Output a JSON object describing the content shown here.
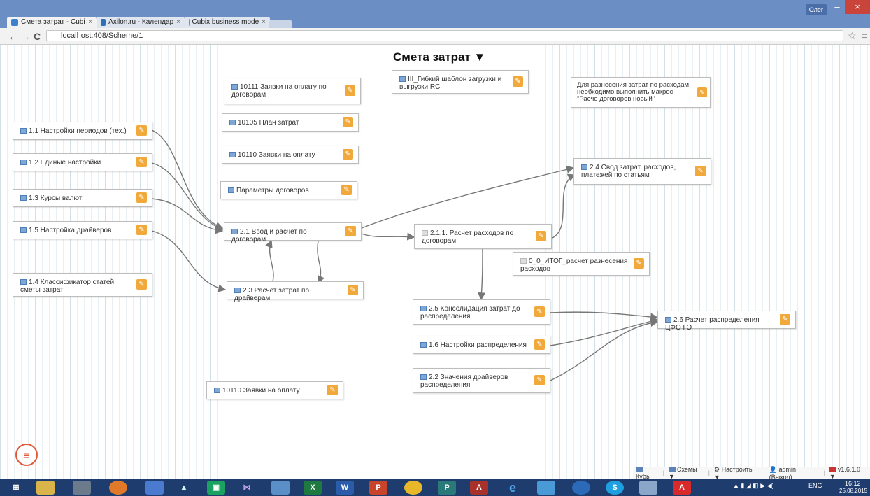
{
  "browser": {
    "tabs": [
      {
        "label": "Смета затрат - Cubi",
        "active": true
      },
      {
        "label": "Axilon.ru - Календар",
        "active": false
      },
      {
        "label": "Cubix business mode",
        "active": false
      }
    ],
    "user_badge": "Олег",
    "url": "localhost:408/Scheme/1"
  },
  "page": {
    "title": "Смета затрат ▼"
  },
  "nodes": [
    {
      "id": "n11",
      "label": "1.1 Настройки периодов (тех.)"
    },
    {
      "id": "n12",
      "label": "1.2 Единые настройки"
    },
    {
      "id": "n13",
      "label": "1.3 Курсы валют"
    },
    {
      "id": "n15",
      "label": "1.5 Настройка драйверов"
    },
    {
      "id": "n14",
      "label": "1.4 Классификатор статей сметы затрат"
    },
    {
      "id": "n10111",
      "label": "10111 Заявки на оплату по договорам"
    },
    {
      "id": "n10105",
      "label": "10105 План затрат"
    },
    {
      "id": "n10110a",
      "label": "10110 Заявки на оплату"
    },
    {
      "id": "nparams",
      "label": "Параметры договоров"
    },
    {
      "id": "n21",
      "label": "2.1 Ввод и расчет по договорам"
    },
    {
      "id": "n23",
      "label": "2.3 Расчет затрат по драйверам"
    },
    {
      "id": "n10110b",
      "label": "10110 Заявки на оплату"
    },
    {
      "id": "nflex",
      "label": "III_Гибкий шаблон загрузки и выгрузки RC"
    },
    {
      "id": "n211",
      "label": "2.1.1. Расчет расходов по договорам"
    },
    {
      "id": "nitog",
      "label": "0_0_ИТОГ_расчет разнесения расходов"
    },
    {
      "id": "n25",
      "label": "2.5 Консолидация затрат до распределения"
    },
    {
      "id": "n16",
      "label": "1.6 Настройки распределения"
    },
    {
      "id": "n22",
      "label": "2.2 Значения драйверов распределения"
    },
    {
      "id": "n24",
      "label": "2.4 Свод затрат, расходов, платежей по статьям"
    },
    {
      "id": "n26",
      "label": "2.6 Расчет распределения ЦФО ГО"
    }
  ],
  "note": {
    "text": "Для разнесения затрат по расходам необходимо выполнить макрос \"Расче договоров новый\""
  },
  "footer": {
    "cubes": "Кубы",
    "schemes": "Схемы ▼",
    "settings": "Настроить ▼",
    "user": "admin (Выход)",
    "version": "v1.6.1.0 ▼"
  },
  "taskbar": {
    "lang": "ENG",
    "time": "16:12",
    "date": "25.08.2015"
  },
  "colors": {
    "titlebar": "#6b8ec5",
    "edit_button": "#f2a93b",
    "taskbar": "#1e3c6e",
    "link": "#777777"
  }
}
